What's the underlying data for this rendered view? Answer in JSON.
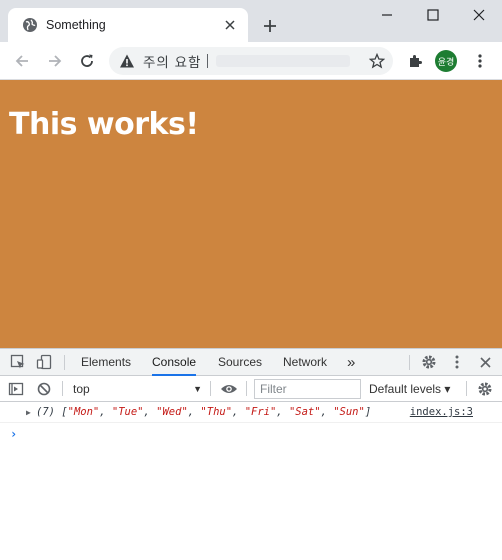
{
  "browser": {
    "tab_title": "Something",
    "security_label": "주의 요함",
    "profile_initials": "윤경"
  },
  "page": {
    "heading": "This works!",
    "background": "#cd853f"
  },
  "devtools": {
    "tabs": [
      "Elements",
      "Console",
      "Sources",
      "Network"
    ],
    "more_label": "»",
    "active_tab": "Console",
    "context": "top",
    "filter_placeholder": "Filter",
    "levels_label": "Default levels ▾",
    "log": {
      "count": "(7)",
      "items": [
        "\"Mon\"",
        "\"Tue\"",
        "\"Wed\"",
        "\"Thu\"",
        "\"Fri\"",
        "\"Sat\"",
        "\"Sun\""
      ],
      "source": "index.js:3"
    },
    "prompt": "›"
  }
}
